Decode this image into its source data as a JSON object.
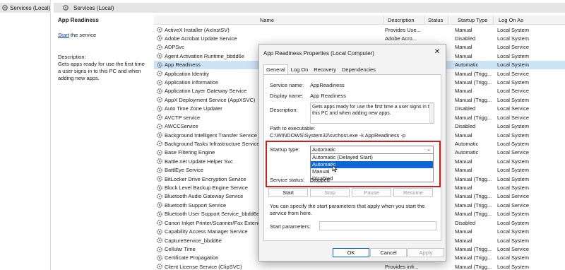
{
  "tree": {
    "label": "Services (Local)"
  },
  "header": {
    "title": "Services (Local)"
  },
  "desc_panel": {
    "title": "App Readiness",
    "start_link": "Start",
    "start_suffix": " the service",
    "description_label": "Description:",
    "description_text": "Gets apps ready for use the first time a user signs in to this PC and when adding new apps."
  },
  "columns": {
    "name": "Name",
    "description": "Description",
    "status": "Status",
    "startup_type": "Startup Type",
    "log_on_as": "Log On As"
  },
  "services": [
    {
      "name": "ActiveX Installer (AxInstSV)",
      "description": "Provides Use...",
      "status": "",
      "startup": "Manual",
      "logon": "Local System"
    },
    {
      "name": "Adobe Acrobat Update Service",
      "description": "Adobe Acro...",
      "status": "",
      "startup": "Disabled",
      "logon": "Local System"
    },
    {
      "name": "ADPSvc",
      "description": "",
      "status": "",
      "startup": "Manual",
      "logon": "Local Service"
    },
    {
      "name": "Agent Activation Runtime_bbdd6e",
      "description": "",
      "status": "",
      "startup": "Manual",
      "logon": "Local System"
    },
    {
      "name": "App Readiness",
      "description": "",
      "status": "",
      "startup": "Automatic",
      "logon": "Local System"
    },
    {
      "name": "Application Identity",
      "description": "",
      "status": "",
      "startup": "Manual (Trigg...",
      "logon": "Local Service"
    },
    {
      "name": "Application Information",
      "description": "",
      "status": "",
      "startup": "Manual (Trigg...",
      "logon": "Local System"
    },
    {
      "name": "Application Layer Gateway Service",
      "description": "",
      "status": "",
      "startup": "Manual",
      "logon": "Local Service"
    },
    {
      "name": "AppX Deployment Service (AppXSVC)",
      "description": "",
      "status": "",
      "startup": "Manual (Trigg...",
      "logon": "Local System"
    },
    {
      "name": "Auto Time Zone Updater",
      "description": "",
      "status": "",
      "startup": "Disabled",
      "logon": "Local Service"
    },
    {
      "name": "AVCTP service",
      "description": "",
      "status": "",
      "startup": "Manual (Trigg...",
      "logon": "Local Service"
    },
    {
      "name": "AWCCService",
      "description": "",
      "status": "",
      "startup": "Disabled",
      "logon": "Local System"
    },
    {
      "name": "Background Intelligent Transfer Service",
      "description": "",
      "status": "",
      "startup": "Manual",
      "logon": "Local System"
    },
    {
      "name": "Background Tasks Infrastructure Service",
      "description": "",
      "status": "",
      "startup": "Automatic",
      "logon": "Local System"
    },
    {
      "name": "Base Filtering Engine",
      "description": "",
      "status": "",
      "startup": "Automatic",
      "logon": "Local Service"
    },
    {
      "name": "Battle.net Update Helper Svc",
      "description": "",
      "status": "",
      "startup": "Manual",
      "logon": "Local System"
    },
    {
      "name": "BattlEye Service",
      "description": "",
      "status": "",
      "startup": "Manual",
      "logon": "Local System"
    },
    {
      "name": "BitLocker Drive Encryption Service",
      "description": "",
      "status": "",
      "startup": "Manual (Trigg...",
      "logon": "Local System"
    },
    {
      "name": "Block Level Backup Engine Service",
      "description": "",
      "status": "",
      "startup": "Manual",
      "logon": "Local System"
    },
    {
      "name": "Bluetooth Audio Gateway Service",
      "description": "",
      "status": "",
      "startup": "Manual (Trigg...",
      "logon": "Local Service"
    },
    {
      "name": "Bluetooth Support Service",
      "description": "",
      "status": "",
      "startup": "Manual (Trigg...",
      "logon": "Local Service"
    },
    {
      "name": "Bluetooth User Support Service_bbdd6e",
      "description": "",
      "status": "",
      "startup": "Manual (Trigg...",
      "logon": "Local System"
    },
    {
      "name": "Canon Inkjet Printer/Scanner/Fax Extend",
      "description": "",
      "status": "",
      "startup": "Disabled",
      "logon": "Local System"
    },
    {
      "name": "Capability Access Manager Service",
      "description": "",
      "status": "",
      "startup": "Manual",
      "logon": "Local System"
    },
    {
      "name": "CaptureService_bbdd6e",
      "description": "",
      "status": "",
      "startup": "Manual",
      "logon": "Local System"
    },
    {
      "name": "Cellular Time",
      "description": "",
      "status": "",
      "startup": "Manual (Trigg...",
      "logon": "Local Service"
    },
    {
      "name": "Certificate Propagation",
      "description": "",
      "status": "",
      "startup": "Manual (Trigg...",
      "logon": "Local System"
    },
    {
      "name": "Client License Service (ClipSVC)",
      "description": "Provides infr...",
      "status": "",
      "startup": "Manual (Trigg...",
      "logon": "Local System"
    }
  ],
  "dialog": {
    "title": "App Readiness Properties (Local Computer)",
    "close": "✕",
    "tabs": [
      "General",
      "Log On",
      "Recovery",
      "Dependencies"
    ],
    "service_name_label": "Service name:",
    "service_name_value": "AppReadiness",
    "display_name_label": "Display name:",
    "display_name_value": "App Readiness",
    "description_label": "Description:",
    "description_value": "Gets apps ready for use the first time a user signs in to this PC and when adding new apps.",
    "path_label": "Path to executable:",
    "path_value": "C:\\WINDOWS\\System32\\svchost.exe -k AppReadiness -p",
    "startup_label": "Startup type:",
    "startup_selected": "Automatic",
    "startup_options": [
      "Automatic (Delayed Start)",
      "Automatic",
      "Manual",
      "Disabled"
    ],
    "startup_highlighted_index": 1,
    "service_status_label": "Service status:",
    "service_status_value": "Stopped",
    "buttons": {
      "start": "Start",
      "stop": "Stop",
      "pause": "Pause",
      "resume": "Resume"
    },
    "params_note": "You can specify the start parameters that apply when you start the service from here.",
    "start_params_label": "Start parameters:",
    "footer": {
      "ok": "OK",
      "cancel": "Cancel",
      "apply": "Apply"
    }
  },
  "colors": {
    "accent": "#0f67d7",
    "highlight_box": "#d0201c",
    "selection": "#cde4f7",
    "link": "#0645ad"
  },
  "icons": {
    "service": "gear-icon",
    "tree": "services-icon",
    "close": "close-icon",
    "chevron": "chevron-down-icon",
    "cursor": "mouse-cursor-icon"
  }
}
